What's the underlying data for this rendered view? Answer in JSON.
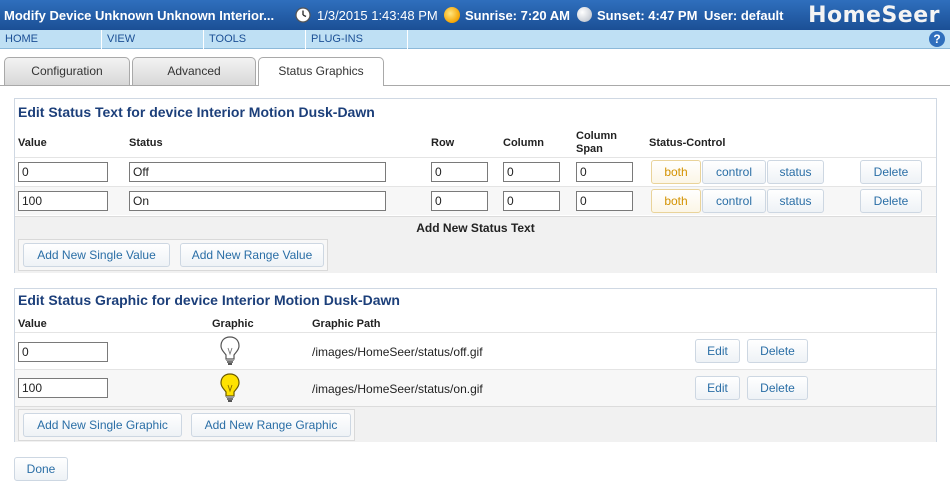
{
  "header": {
    "title": "Modify Device Unknown Unknown Interior...",
    "datetime": "1/3/2015 1:43:48 PM",
    "sunrise": "Sunrise: 7:20 AM",
    "sunset": "Sunset: 4:47 PM",
    "user": "User: default",
    "logo": "HomeSeer"
  },
  "menu": {
    "items": [
      "HOME",
      "VIEW",
      "TOOLS",
      "PLUG-INS"
    ],
    "help": "?"
  },
  "tabs": {
    "configuration": "Configuration",
    "advanced": "Advanced",
    "status_graphics": "Status Graphics"
  },
  "status_text": {
    "title": "Edit Status Text for device Interior Motion Dusk-Dawn",
    "headers": {
      "value": "Value",
      "status": "Status",
      "row": "Row",
      "column": "Column",
      "column_span_1": "Column",
      "column_span_2": "Span",
      "status_control": "Status-Control"
    },
    "rows": [
      {
        "value": "0",
        "status": "Off",
        "row": "0",
        "column": "0",
        "span": "0"
      },
      {
        "value": "100",
        "status": "On",
        "row": "0",
        "column": "0",
        "span": "0"
      }
    ],
    "buttons": {
      "both": "both",
      "control": "control",
      "status": "status",
      "delete": "Delete"
    },
    "add_title": "Add New Status Text",
    "add_single": "Add New Single Value",
    "add_range": "Add New Range Value"
  },
  "status_graphic": {
    "title": "Edit Status Graphic for device Interior Motion Dusk-Dawn",
    "headers": {
      "value": "Value",
      "graphic": "Graphic",
      "graphic_path": "Graphic Path"
    },
    "rows": [
      {
        "value": "0",
        "path": "/images/HomeSeer/status/off.gif",
        "icon": "bulb-off-icon"
      },
      {
        "value": "100",
        "path": "/images/HomeSeer/status/on.gif",
        "icon": "bulb-on-icon"
      }
    ],
    "buttons": {
      "edit": "Edit",
      "delete": "Delete"
    },
    "add_single": "Add New Single Graphic",
    "add_range": "Add New Range Graphic"
  },
  "footer": {
    "done": "Done"
  },
  "colors": {
    "title_bar": "#1b4f95",
    "menu_bar": "#bfe0f4",
    "panel_title": "#1c3f7a",
    "link_button": "#2a6ea6",
    "both_button": "#d39200"
  }
}
